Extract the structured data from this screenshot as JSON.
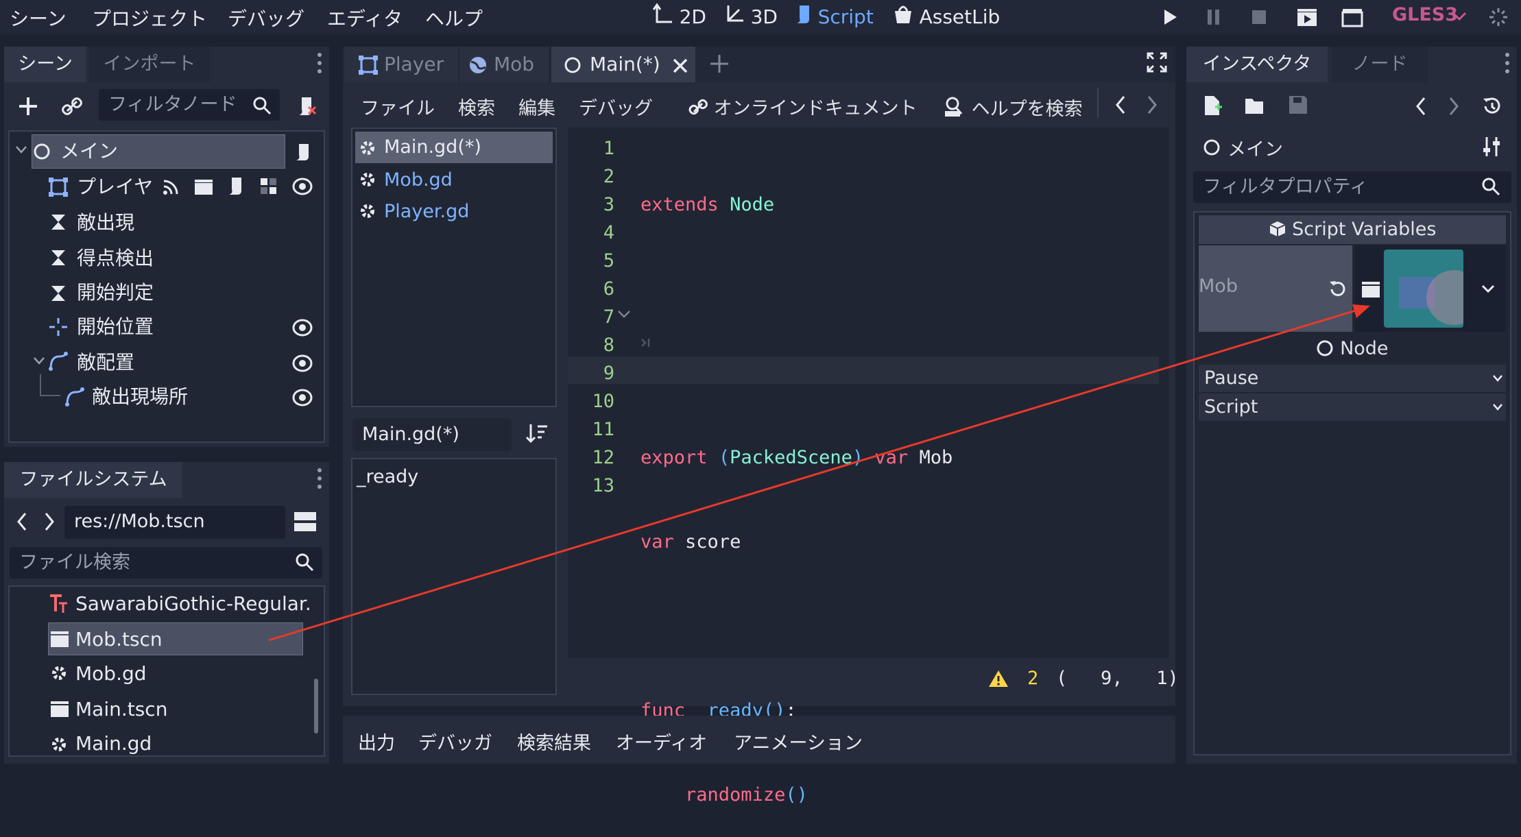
{
  "menu": {
    "scene": "シーン",
    "project": "プロジェクト",
    "debug": "デバッグ",
    "editor": "エディタ",
    "help": "ヘルプ"
  },
  "workspaces": {
    "ws2d": "2D",
    "ws3d": "3D",
    "script": "Script",
    "assetlib": "AssetLib"
  },
  "renderer": "GLES3",
  "scene_dock": {
    "tab_scene": "シーン",
    "tab_import": "インポート",
    "filter_placeholder": "フィルタノード",
    "nodes": [
      {
        "label": "メイン"
      },
      {
        "label": "プレイヤ"
      },
      {
        "label": "敵出現"
      },
      {
        "label": "得点検出"
      },
      {
        "label": "開始判定"
      },
      {
        "label": "開始位置"
      },
      {
        "label": "敵配置"
      },
      {
        "label": "敵出現場所"
      }
    ]
  },
  "filesystem": {
    "tab": "ファイルシステム",
    "path": "res://Mob.tscn",
    "search_placeholder": "ファイル検索",
    "files": [
      {
        "label": "SawarabiGothic-Regular."
      },
      {
        "label": "Mob.tscn"
      },
      {
        "label": "Mob.gd"
      },
      {
        "label": "Main.tscn"
      },
      {
        "label": "Main.gd"
      }
    ]
  },
  "editor_tabs": {
    "player": "Player",
    "mob": "Mob",
    "main": "Main(*)"
  },
  "script_menu": {
    "file": "ファイル",
    "search": "検索",
    "edit": "編集",
    "debug": "デバッグ",
    "online_docs": "オンラインドキュメント",
    "help_search": "ヘルプを検索"
  },
  "script_list": [
    "Main.gd(*)",
    "Mob.gd",
    "Player.gd"
  ],
  "current_script": "Main.gd(*)",
  "methods": [
    "_ready"
  ],
  "code": {
    "line_numbers": [
      "1",
      "2",
      "3",
      "4",
      "5",
      "6",
      "7",
      "8",
      "9",
      "10",
      "11",
      "12",
      "13"
    ],
    "l1_kw": "extends",
    "l1_type": "Node",
    "l4_kw": "export",
    "l4_open": "(",
    "l4_type": "PackedScene",
    "l4_close": ")",
    "l4_kw2": "var",
    "l4_id": "Mob",
    "l5_kw": "var",
    "l5_id": "score",
    "l7_kw": "func",
    "l7_fn": "_ready",
    "l7_parens": "()",
    "l7_colon": ":",
    "l8_fn": "randomize",
    "l8_parens": "()"
  },
  "status": {
    "warnings": "2",
    "position": "(   9,   1)"
  },
  "bottom_tabs": {
    "output": "出力",
    "debugger": "デバッガ",
    "search_results": "検索結果",
    "audio": "オーディオ",
    "animation": "アニメーション"
  },
  "inspector": {
    "tab_inspector": "インスペクタ",
    "tab_node": "ノード",
    "object_name": "メイン",
    "filter_placeholder": "フィルタプロパティ",
    "section_title": "Script Variables",
    "property_mob": "Mob",
    "node_section": "Node",
    "pause": "Pause",
    "script": "Script"
  },
  "colors": {
    "accent": "#6fa8ff",
    "arrow": "#e8392a",
    "warning": "#ffd54a",
    "renderer": "#c8578f"
  }
}
